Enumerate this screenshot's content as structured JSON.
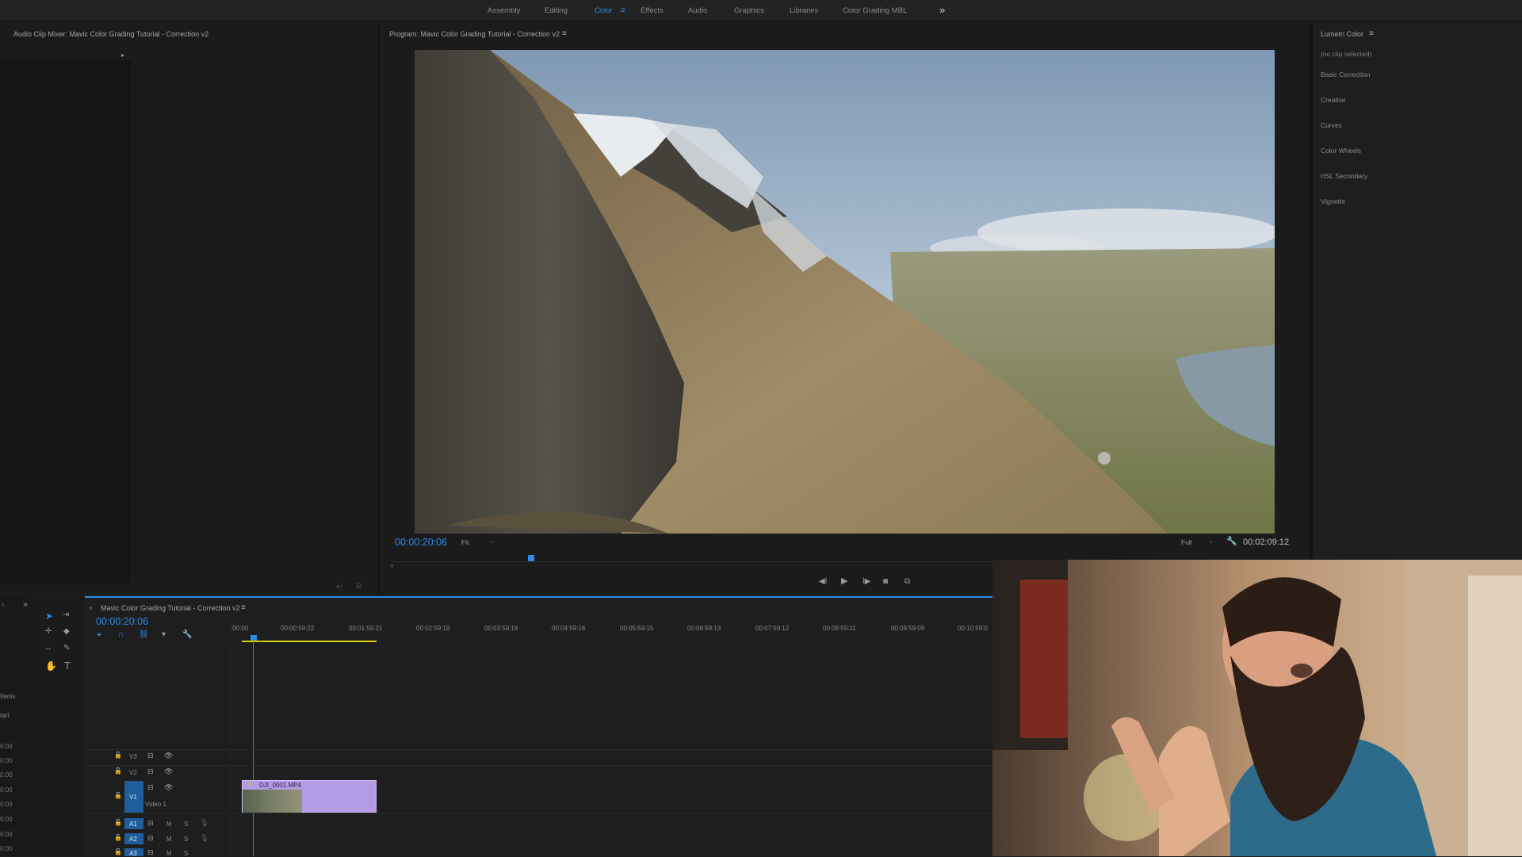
{
  "workspaces": {
    "tabs": [
      {
        "label": "Assembly",
        "active": false
      },
      {
        "label": "Editing",
        "active": false
      },
      {
        "label": "Color",
        "active": true
      },
      {
        "label": "Effects",
        "active": false
      },
      {
        "label": "Audio",
        "active": false
      },
      {
        "label": "Graphics",
        "active": false
      },
      {
        "label": "Libraries",
        "active": false
      },
      {
        "label": "Color Grading MBL",
        "active": false
      }
    ],
    "overflow_icon": "double-chevron-right-icon"
  },
  "audio_mixer": {
    "title": "Audio Clip Mixer: Mavic Color Grading Tutorial - Correction v2"
  },
  "program_monitor": {
    "title": "Program: Mavic Color Grading Tutorial - Correction v2",
    "current_time": "00:00:20:06",
    "zoom": "Fit",
    "resolution": "Full",
    "duration": "00:02:09:12"
  },
  "lumetri": {
    "title": "Lumetri Color",
    "clip_status": "(no clip selected)",
    "sections": [
      "Basic Correction",
      "Creative",
      "Curves",
      "Color Wheels",
      "HSL Secondary",
      "Vignette"
    ]
  },
  "timeline": {
    "sequence_name": "Mavic Color Grading Tutorial - Correction v2",
    "current_time": "00:00:20:06",
    "ruler": ":00:00",
    "ruler_labels": [
      "00:00:59:22",
      "00:01:59:21",
      "00:02:59:19",
      "00:03:59:18",
      "00:04:59:16",
      "00:05:59:15",
      "00:06:59:13",
      "00:07:59:12",
      "00:08:59:11",
      "00:09:59:09",
      "00:10:59:0"
    ],
    "tracks": {
      "v3": "V3",
      "v2": "V2",
      "v1": "V1",
      "video1_name": "Video 1",
      "a1": "A1",
      "a2": "A2",
      "a3": "A3"
    },
    "clip_name": "DJI_0001.MP4",
    "mute_label": "M",
    "solo_label": "S"
  },
  "project_strip": {
    "items_label": "Items",
    "start_label": "tart",
    "times": [
      "0:00",
      "0:00",
      "0:00",
      "0:00",
      "0:00",
      "0:00",
      "0:00",
      "0:00"
    ]
  },
  "colors": {
    "accent": "#2d8ceb",
    "clip": "#b49be6",
    "work_area": "#d7d100"
  }
}
